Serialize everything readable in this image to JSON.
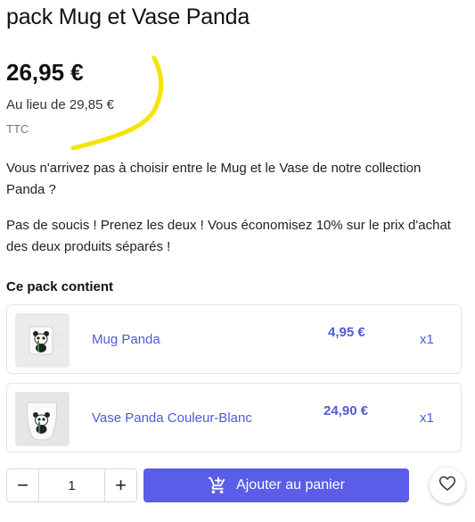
{
  "product": {
    "title": "pack Mug et Vase Panda",
    "price": "26,95 €",
    "old_price": "Au lieu de 29,85 €",
    "tax_label": "TTC"
  },
  "description": {
    "paragraph1": "Vous n'arrivez pas à choisir entre le Mug et le Vase de notre collection Panda ?",
    "paragraph2": "Pas de soucis ! Prenez les deux ! Vous économisez 10%  sur le prix d'achat des deux produits séparés !"
  },
  "pack": {
    "title": "Ce pack contient",
    "items": [
      {
        "name": "Mug Panda",
        "price": "4,95 €",
        "qty": "x1"
      },
      {
        "name": "Vase Panda Couleur-Blanc",
        "price": "24,90 €",
        "qty": "x1"
      }
    ]
  },
  "cart": {
    "minus_label": "−",
    "plus_label": "+",
    "quantity": "1",
    "add_label": "Ajouter au panier",
    "cart_icon": "cart-icon",
    "favorite_icon": "heart-icon"
  },
  "colors": {
    "accent": "#5a5de8",
    "link": "#4f5bd5",
    "annotation": "#f5e400"
  }
}
